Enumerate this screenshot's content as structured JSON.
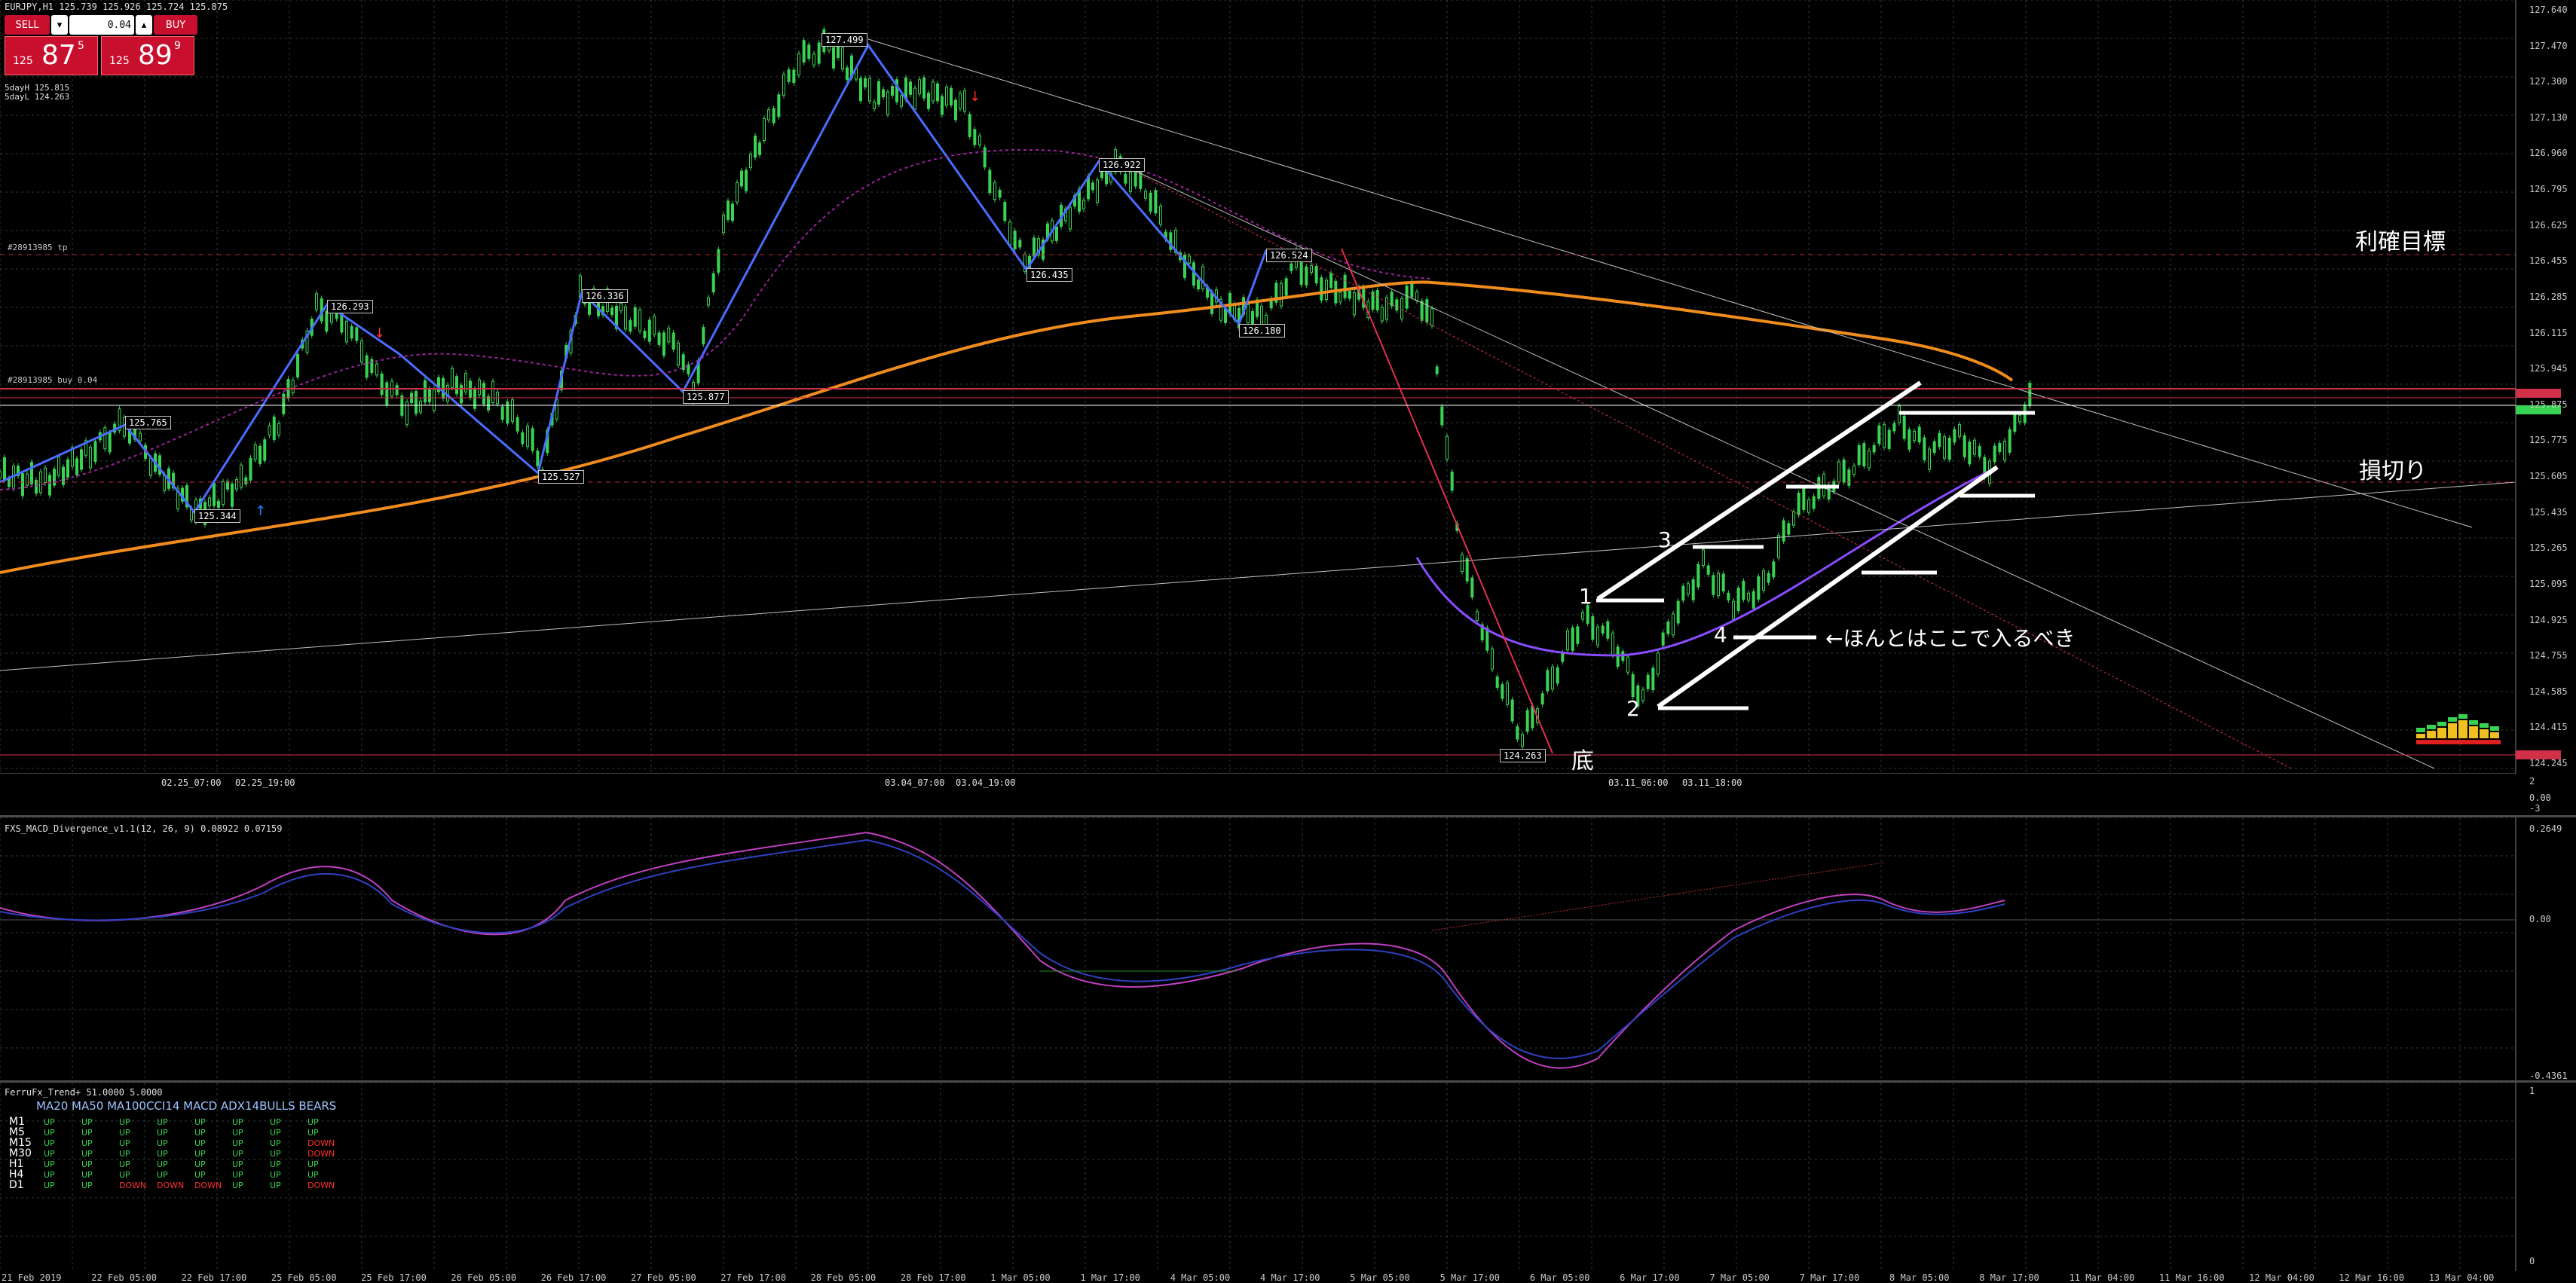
{
  "window": {
    "symbol_line": "EURJPY,H1  125.739 125.926 125.724 125.875",
    "day_high": "5dayH 125.815",
    "day_low": "5dayL 124.263"
  },
  "trade_panel": {
    "sell_label": "SELL",
    "buy_label": "BUY",
    "lot": "0.04",
    "sell_small": "125",
    "sell_big": "87",
    "sell_sup": "5",
    "buy_small": "125",
    "buy_big": "89",
    "buy_sup": "9"
  },
  "orders": {
    "tp_label": "#28913985 tp",
    "buy_label": "#28913985 buy 0.04"
  },
  "annotations": {
    "take_profit": "利確目標",
    "stop_loss": "損切り",
    "entry_note": "←ほんとはここで入るべき",
    "bottom": "底",
    "n1": "1",
    "n2": "2",
    "n3": "3",
    "n4": "4"
  },
  "swing_labels": [
    "127.499",
    "126.922",
    "126.524",
    "126.435",
    "126.180",
    "126.293",
    "126.336",
    "125.877",
    "125.765",
    "125.344",
    "125.527",
    "124.263"
  ],
  "price_axis": [
    "127.640",
    "127.470",
    "127.300",
    "127.130",
    "126.960",
    "126.795",
    "126.625",
    "126.455",
    "126.285",
    "126.115",
    "125.945",
    "125.875",
    "125.775",
    "125.605",
    "125.435",
    "125.265",
    "125.095",
    "124.925",
    "124.755",
    "124.585",
    "124.415",
    "124.245"
  ],
  "time_markers": [
    "02.25_07:00",
    "02.25_19:00",
    "03.04_07:00",
    "03.04_19:00",
    "03.11_06:00",
    "03.11_18:00"
  ],
  "macd": {
    "title": "FXS_MACD_Divergence_v1.1(12, 26, 9) 0.08922 0.07159",
    "axis": [
      "0.2649",
      "0.00",
      "-0.4361"
    ]
  },
  "lower_axis": [
    "2",
    "0.00",
    "-3"
  ],
  "trend": {
    "title": "FerruFx_Trend+ 51.0000 5.0000",
    "header": "MA20  MA50 MA100CCI14  MACD ADX14BULLS BEARS",
    "rows": [
      {
        "tf": "M1",
        "vals": [
          "UP",
          "UP",
          "UP",
          "UP",
          "UP",
          "UP",
          "UP",
          "UP"
        ]
      },
      {
        "tf": "M5",
        "vals": [
          "UP",
          "UP",
          "UP",
          "UP",
          "UP",
          "UP",
          "UP",
          "UP"
        ]
      },
      {
        "tf": "M15",
        "vals": [
          "UP",
          "UP",
          "UP",
          "UP",
          "UP",
          "UP",
          "UP",
          "DOWN"
        ]
      },
      {
        "tf": "M30",
        "vals": [
          "UP",
          "UP",
          "UP",
          "UP",
          "UP",
          "UP",
          "UP",
          "DOWN"
        ]
      },
      {
        "tf": "H1",
        "vals": [
          "UP",
          "UP",
          "UP",
          "UP",
          "UP",
          "UP",
          "UP",
          "UP"
        ]
      },
      {
        "tf": "H4",
        "vals": [
          "UP",
          "UP",
          "UP",
          "UP",
          "UP",
          "UP",
          "UP",
          "UP"
        ]
      },
      {
        "tf": "D1",
        "vals": [
          "UP",
          "UP",
          "DOWN",
          "DOWN",
          "DOWN",
          "UP",
          "UP",
          "DOWN"
        ]
      }
    ],
    "axis": [
      "1",
      "0"
    ]
  },
  "x_axis": [
    "21 Feb 2019",
    "22 Feb 05:00",
    "22 Feb 17:00",
    "25 Feb 05:00",
    "25 Feb 17:00",
    "26 Feb 05:00",
    "26 Feb 17:00",
    "27 Feb 05:00",
    "27 Feb 17:00",
    "28 Feb 05:00",
    "28 Feb 17:00",
    "1 Mar 05:00",
    "1 Mar 17:00",
    "4 Mar 05:00",
    "4 Mar 17:00",
    "5 Mar 05:00",
    "5 Mar 17:00",
    "6 Mar 05:00",
    "6 Mar 17:00",
    "7 Mar 05:00",
    "7 Mar 17:00",
    "8 Mar 05:00",
    "8 Mar 17:00",
    "11 Mar 04:00",
    "11 Mar 16:00",
    "12 Mar 04:00",
    "12 Mar 16:00",
    "13 Mar 04:00"
  ],
  "colors": {
    "bg": "#000000",
    "grid": "#2e3a3a",
    "candle": "#39d353",
    "ma": "#f08c1e",
    "zigzag": "#4a6cff",
    "envelope": "#a020a0",
    "hline": "#c0283c",
    "white": "#ffffff"
  }
}
